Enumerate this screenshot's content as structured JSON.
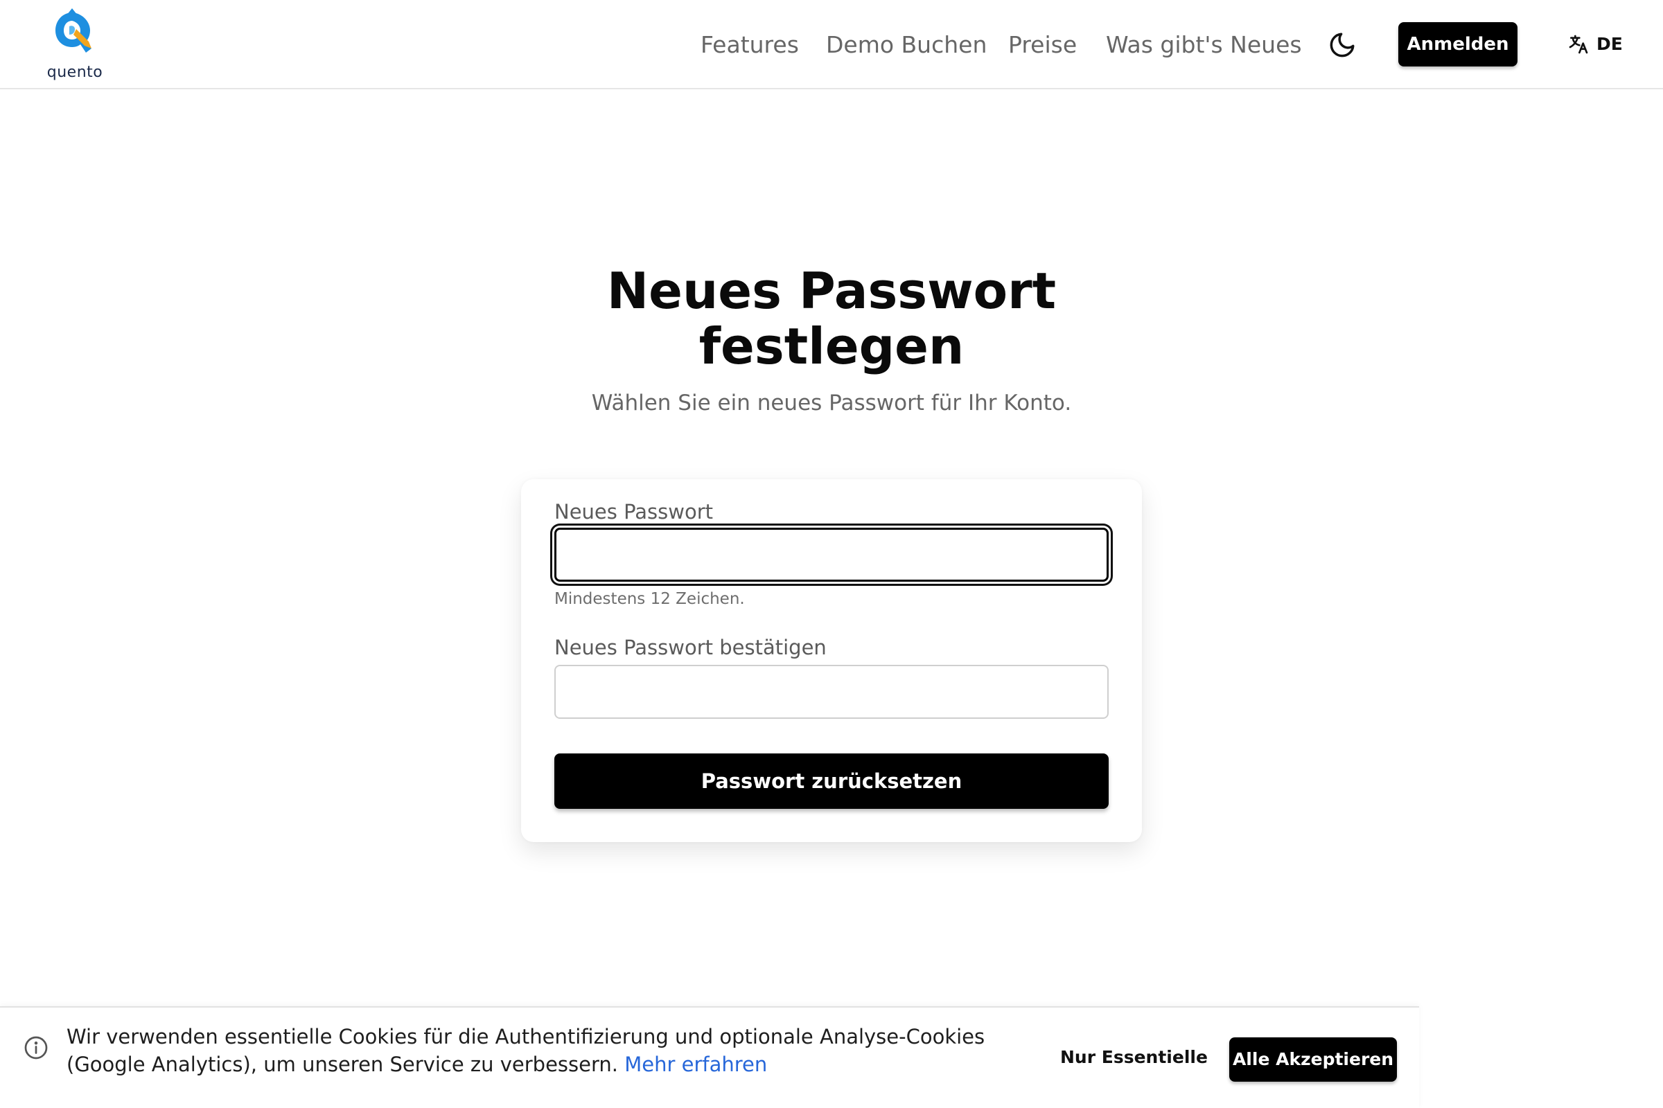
{
  "header": {
    "logo_text": "quento",
    "nav": [
      {
        "label": "Features"
      },
      {
        "label": "Demo Buchen"
      },
      {
        "label": "Preise"
      },
      {
        "label": "Was gibt's Neues"
      }
    ],
    "theme_toggle_icon": "moon-icon",
    "login_label": "Anmelden",
    "language_icon": "translate-icon",
    "language_code": "DE"
  },
  "main": {
    "title_line1": "Neues Passwort",
    "title_line2": "festlegen",
    "subtitle": "Wählen Sie ein neues Passwort für Ihr Konto."
  },
  "form": {
    "new_password_label": "Neues Passwort",
    "new_password_value": "",
    "new_password_hint": "Mindestens 12 Zeichen.",
    "confirm_password_label": "Neues Passwort bestätigen",
    "confirm_password_value": "",
    "submit_label": "Passwort zurücksetzen"
  },
  "cookie_banner": {
    "info_icon": "info-icon",
    "text": "Wir verwenden essentielle Cookies für die Authentifizierung und optionale Analyse-Cookies (Google Analytics), um unseren Service zu verbessern.",
    "link_label": "Mehr erfahren",
    "essential_label": "Nur Essentielle",
    "accept_label": "Alle Akzeptieren"
  },
  "colors": {
    "primary": "#000000",
    "link": "#2767d9",
    "logo_blue": "#1e8fe0",
    "logo_orange": "#f2a51f"
  }
}
